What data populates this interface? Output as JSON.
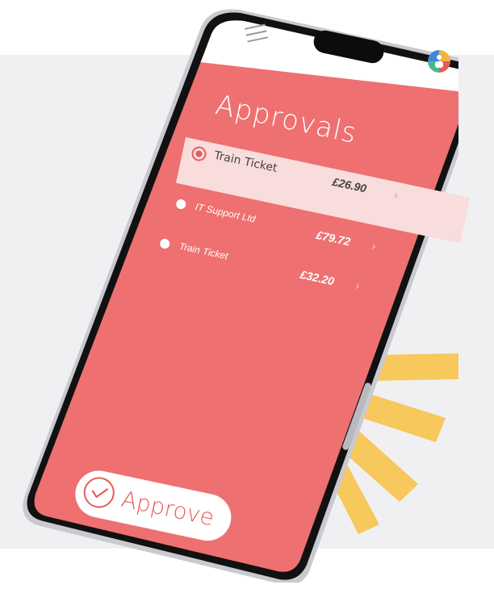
{
  "screen": {
    "title": "Approvals",
    "items": [
      {
        "label": "Train Ticket",
        "amount": "£26.90",
        "selected": true
      },
      {
        "label": "IT Support Ltd",
        "amount": "£79.72",
        "selected": false
      },
      {
        "label": "Train Ticket",
        "amount": "£32.20",
        "selected": false
      }
    ],
    "approve_label": "Approve"
  },
  "colors": {
    "screen": "#ee7070",
    "selected_row": "#f9dcdc",
    "rays": "#f7c85b",
    "background_panel": "#f0f0f3"
  }
}
